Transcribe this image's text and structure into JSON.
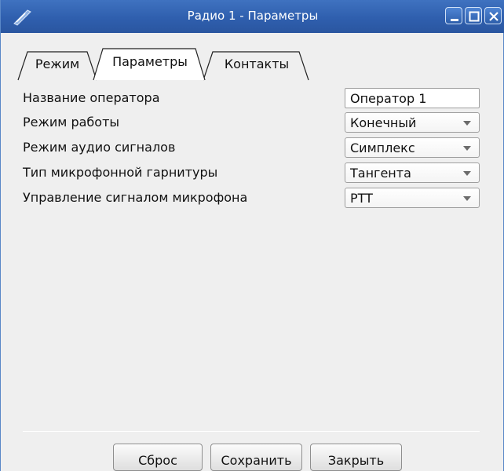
{
  "window": {
    "title": "Радио 1 - Параметры",
    "controls": {
      "minimize_icon": "minimize-icon",
      "maximize_icon": "maximize-icon",
      "close_icon": "close-icon"
    },
    "colors": {
      "titlebar": "#2f5fae",
      "background": "#efefef"
    }
  },
  "tabs": [
    {
      "label": "Режим",
      "active": false
    },
    {
      "label": "Параметры",
      "active": true
    },
    {
      "label": "Контакты",
      "active": false
    }
  ],
  "form": {
    "operator_name": {
      "label": "Название оператора",
      "value": "Оператор 1"
    },
    "work_mode": {
      "label": "Режим работы",
      "value": "Конечный"
    },
    "audio_mode": {
      "label": "Режим аудио сигналов",
      "value": "Симплекс"
    },
    "headset_type": {
      "label": "Тип микрофонной гарнитуры",
      "value": "Тангента"
    },
    "mic_control": {
      "label": "Управление сигналом микрофона",
      "value": "PTT"
    }
  },
  "buttons": {
    "reset": "Сброс",
    "save": "Сохранить",
    "close": "Закрыть"
  }
}
